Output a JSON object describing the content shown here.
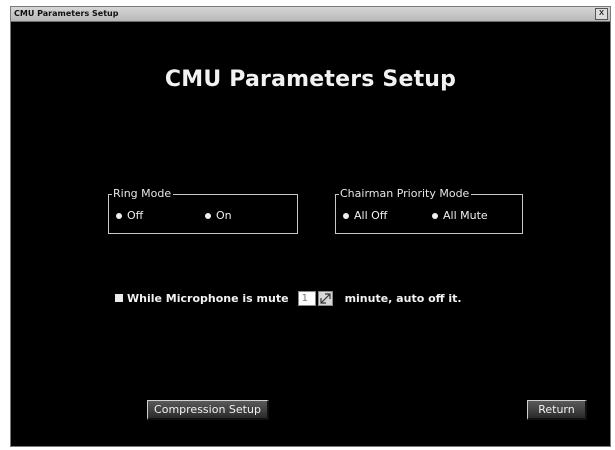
{
  "window": {
    "title": "CMU Parameters Setup",
    "close_glyph": "x",
    "close_icon": "close-icon"
  },
  "heading": "CMU Parameters Setup",
  "ring_mode": {
    "legend": "Ring Mode",
    "options": [
      {
        "label": "Off"
      },
      {
        "label": "On"
      }
    ]
  },
  "chairman_priority_mode": {
    "legend": "Chairman Priority Mode",
    "options": [
      {
        "label": "All Off"
      },
      {
        "label": "All Mute"
      }
    ]
  },
  "auto_off": {
    "label_before": "While Microphone is mute",
    "minutes_value": "1",
    "label_after": "minute, auto off it."
  },
  "buttons": {
    "compression_setup": "Compression Setup",
    "return": "Return"
  }
}
